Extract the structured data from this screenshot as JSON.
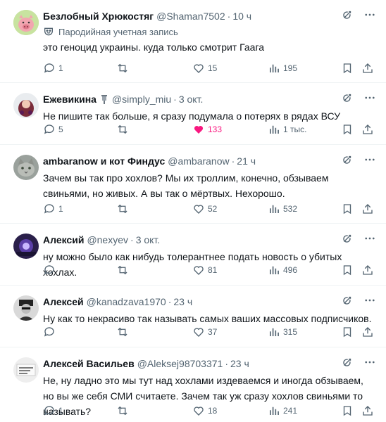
{
  "tweets": [
    {
      "name": "Безлобный Хрюкостяг",
      "handle": "@Shaman7502",
      "time": "10 ч",
      "parody": "Пародийная учетная запись",
      "text": "это геноцид украины. куда только смотрит Гаага",
      "replies": "1",
      "retweets": "",
      "likes": "15",
      "views": "195",
      "liked": false
    },
    {
      "name": "Ежевикина",
      "handle": "@simply_miu",
      "time": "3 окт.",
      "text": "Не пишите так больше, я сразу подумала о потерях в рядах ВСУ",
      "replies": "5",
      "retweets": "",
      "likes": "133",
      "views": "1 тыс.",
      "liked": true
    },
    {
      "name": "ambaranow и кот Финдус",
      "handle": "@ambaranow",
      "time": "21 ч",
      "text": "Зачем вы так про хохлов? Мы их троллим, конечно, обзываем свиньями, но живых. А вы так о мёртвых. Нехорошо.",
      "replies": "1",
      "retweets": "",
      "likes": "52",
      "views": "532",
      "liked": false
    },
    {
      "name": "Алексий",
      "handle": "@nexyev",
      "time": "3 окт.",
      "text": "ну можно было как нибудь толерантнее подать новость о убитых хохлах.",
      "replies": "",
      "retweets": "",
      "likes": "81",
      "views": "496",
      "liked": false
    },
    {
      "name": "Алексей",
      "handle": "@kanadzava1970",
      "time": "23 ч",
      "text": "Ну как то некрасиво так называть самых ваших массовых подписчиков.",
      "replies": "",
      "retweets": "",
      "likes": "37",
      "views": "315",
      "liked": false
    },
    {
      "name": "Алексей Васильев",
      "handle": "@Aleksej98703371",
      "time": "23 ч",
      "text": "Не, ну ладно это мы тут над хохлами издеваемся и иногда обзываем, но вы же себя СМИ считаете. Зачем так уж сразу хохлов свиньями то называть?",
      "replies": "1",
      "retweets": "",
      "likes": "18",
      "views": "241",
      "liked": false
    }
  ],
  "colors": {
    "text": "#0f1419",
    "muted": "#536471",
    "like": "#f91880",
    "divider": "#eff3f4"
  }
}
